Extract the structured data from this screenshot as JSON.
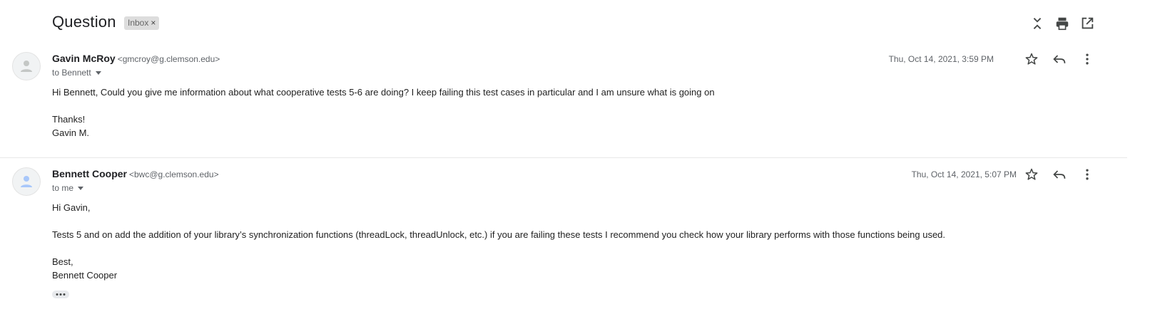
{
  "thread": {
    "subject": "Question",
    "label": "Inbox",
    "label_remove": "×"
  },
  "header_icons": [
    "collapse-all-icon",
    "print-icon",
    "open-in-new-window-icon"
  ],
  "messages": [
    {
      "sender_name": "Gavin McRoy",
      "sender_email": "<gmcroy@g.clemson.edu>",
      "recipient": "to Bennett",
      "date": "Thu, Oct 14, 2021, 3:59 PM",
      "body": [
        "Hi Bennett, Could you give me information about what cooperative tests 5-6 are doing? I keep failing this test cases in particular and I am unsure what is going on",
        "Thanks!",
        "Gavin M."
      ]
    },
    {
      "sender_name": "Bennett Cooper",
      "sender_email": "<bwc@g.clemson.edu>",
      "recipient": "to me",
      "date": "Thu, Oct 14, 2021, 5:07 PM",
      "body": [
        "Hi Gavin,",
        "Tests 5 and on add the addition of your library’s synchronization functions (threadLock, threadUnlock, etc.) if you are failing these tests I recommend you check how your library performs with those functions being used.",
        "Best,",
        "Bennett Cooper"
      ]
    }
  ],
  "colors": {
    "avatar_gavin": "#c4c7c5",
    "avatar_bennett": "#a8c7fa",
    "chip_bg": "#dddddd",
    "icon": "#444746"
  }
}
